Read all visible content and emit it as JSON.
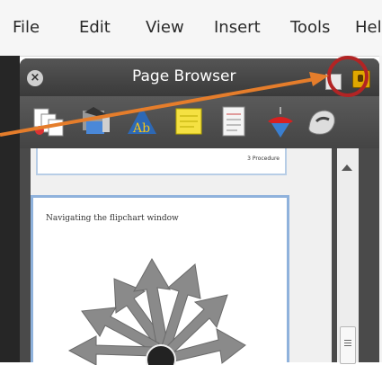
{
  "menu": {
    "items": [
      "File",
      "Edit",
      "View",
      "Insert",
      "Tools",
      "Hel"
    ]
  },
  "panel": {
    "title": "Page Browser",
    "close_glyph": "×"
  },
  "toolbar": {
    "icons": [
      "page-sorter-icon",
      "resource-library-icon",
      "handwriting-icon",
      "notes-icon",
      "properties-icon",
      "spinner-icon",
      "mouse-icon"
    ]
  },
  "pages": {
    "thumb1_label": "3 Procedure",
    "thumb2_title": "Navigating the flipchart window"
  },
  "colors": {
    "accent_arrow": "#e57d2b",
    "highlight_circle": "#b22424",
    "panel_bg": "#4a4a4a",
    "selected_border": "#8fb2dc"
  }
}
